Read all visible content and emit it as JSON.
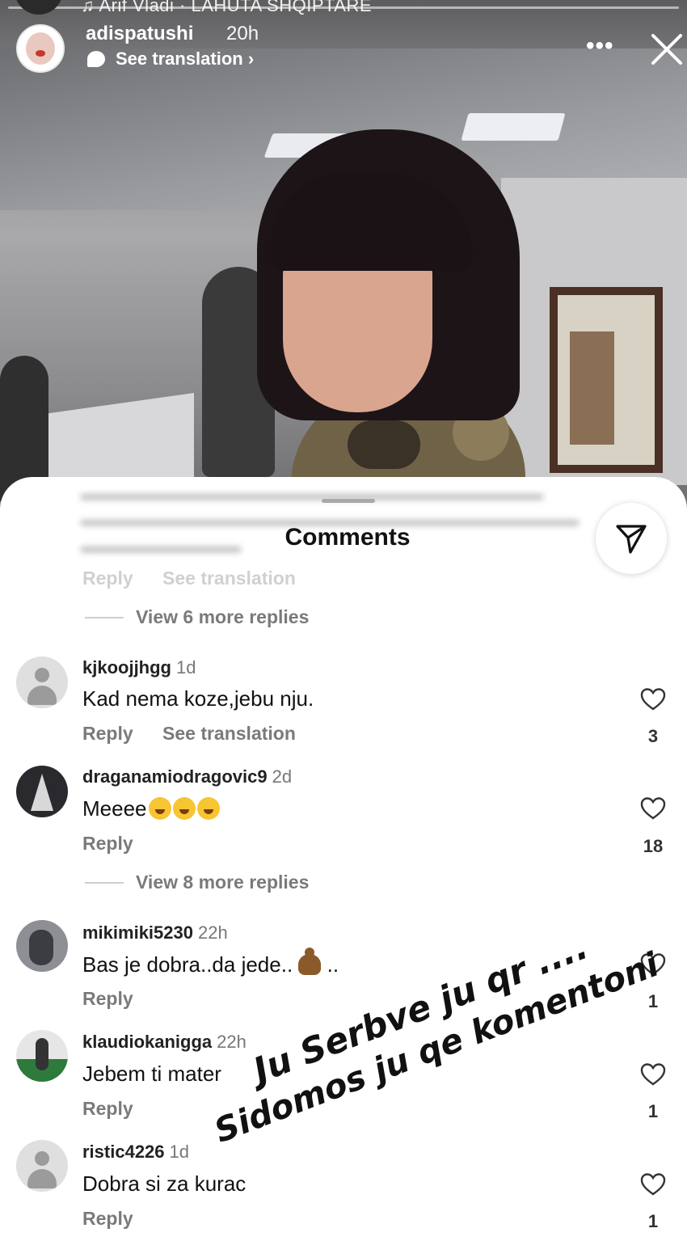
{
  "story": {
    "music": "♫ Arif Vladi · LAHUTA SHQIPTARE",
    "username": "adispatushi",
    "time": "20h",
    "see_translation": "See translation ›",
    "more": "•••"
  },
  "sheet": {
    "title": "Comments",
    "first_comment_actions": {
      "reply": "Reply",
      "see_translation": "See translation"
    },
    "view_more_1": "View 6 more replies",
    "view_more_2": "View 8 more replies"
  },
  "comments": [
    {
      "user": "kjkoojjhgg",
      "time": "1d",
      "text": "Kad nema koze,jebu nju.",
      "reply": "Reply",
      "see_translation": "See translation",
      "likes": "3"
    },
    {
      "user": "draganamiodragovic9",
      "time": "2d",
      "text": "Meeee",
      "reply": "Reply",
      "likes": "18"
    },
    {
      "user": "mikimiki5230",
      "time": "22h",
      "text": "Bas je dobra..da jede..",
      "text_suffix": " ..",
      "reply": "Reply",
      "likes": "1"
    },
    {
      "user": "klaudiokanigga",
      "time": "22h",
      "text": "Jebem ti mater",
      "reply": "Reply",
      "likes": "1"
    },
    {
      "user": "ristic4226",
      "time": "1d",
      "text": "Dobra si za kurac",
      "reply": "Reply",
      "likes": "1"
    }
  ],
  "overlay": {
    "line1": "Ju Serbve ju qr ....",
    "line2": "Sidomos ju qe komentoni"
  }
}
